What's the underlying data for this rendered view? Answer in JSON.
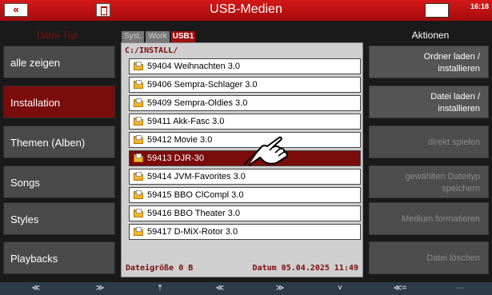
{
  "title": "USB-Medien",
  "time": "16:18",
  "left_header": "Datei-Typ",
  "nav": [
    {
      "label": "alle zeigen"
    },
    {
      "label": "Installation"
    },
    {
      "label": "Themen (Alben)"
    },
    {
      "label": "Songs"
    },
    {
      "label": "Styles"
    },
    {
      "label": "Playbacks"
    }
  ],
  "tabs": [
    {
      "label": "Syst."
    },
    {
      "label": "Work"
    },
    {
      "label": "USB1"
    }
  ],
  "path": "C:/INSTALL/",
  "files": [
    "59404 Weihnachten 3.0",
    "59406 Sempra-Schlager 3.0",
    "59409 Sempra-Oldies 3.0",
    "59411 Akk-Fasc 3.0",
    "59412 Movie 3.0",
    "59413 DJR-30",
    "59414 JVM-Favorites 3.0",
    "59415 BBO ClCompl 3.0",
    "59416 BBO Theater 3.0",
    "59417 D-MiX-Rotor 3.0"
  ],
  "selected_file_index": 5,
  "footer": {
    "size": "Dateigröße 0 B",
    "date": "Datum 05.04.2025  11:49"
  },
  "right_header": "Aktionen",
  "actions": [
    {
      "line1": "Ordner laden /",
      "line2": "installieren",
      "enabled": true
    },
    {
      "line1": "Datei laden /",
      "line2": "installieren",
      "enabled": true
    },
    {
      "line1": "direkt spielen",
      "line2": "",
      "enabled": false
    },
    {
      "line1": "gewählten Dateityp",
      "line2": "speichern",
      "enabled": false
    },
    {
      "line1": "Medium formatieren",
      "line2": "",
      "enabled": false
    },
    {
      "line1": "Datei löschen",
      "line2": "",
      "enabled": false
    }
  ],
  "bottom_buttons": [
    "≪",
    "≫",
    "⤒",
    "≪",
    "≫",
    "˅",
    "≪=",
    "---"
  ],
  "colors": {
    "title_red": "#c41212",
    "selected_red": "#7b0c0c",
    "folder_yellow": "#f1b52c"
  }
}
